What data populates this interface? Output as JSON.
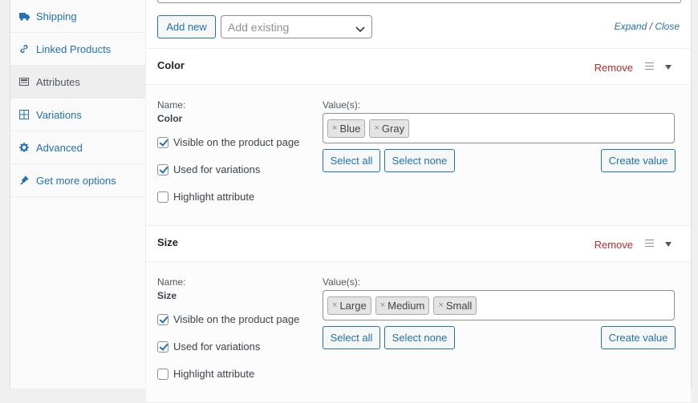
{
  "sidebar": {
    "items": [
      {
        "label": "Shipping",
        "icon": "truck-icon",
        "active": false
      },
      {
        "label": "Linked Products",
        "icon": "link-icon",
        "active": false
      },
      {
        "label": "Attributes",
        "icon": "list-icon",
        "active": true
      },
      {
        "label": "Variations",
        "icon": "grid-icon",
        "active": false
      },
      {
        "label": "Advanced",
        "icon": "gear-icon",
        "active": false
      },
      {
        "label": "Get more options",
        "icon": "plugin-icon",
        "active": false
      }
    ]
  },
  "toolbar": {
    "add_new_label": "Add new",
    "add_existing_placeholder": "Add existing",
    "expand_label": "Expand",
    "separator": "/",
    "close_label": "Close"
  },
  "attributes": [
    {
      "title": "Color",
      "remove_label": "Remove",
      "name_label": "Name:",
      "name_value": "Color",
      "values_label": "Value(s):",
      "values": [
        "Blue",
        "Gray"
      ],
      "visible_label": "Visible on the product page",
      "visible_checked": true,
      "variations_label": "Used for variations",
      "variations_checked": true,
      "highlight_label": "Highlight attribute",
      "highlight_checked": false,
      "select_all_label": "Select all",
      "select_none_label": "Select none",
      "create_value_label": "Create value"
    },
    {
      "title": "Size",
      "remove_label": "Remove",
      "name_label": "Name:",
      "name_value": "Size",
      "values_label": "Value(s):",
      "values": [
        "Large",
        "Medium",
        "Small"
      ],
      "visible_label": "Visible on the product page",
      "visible_checked": true,
      "variations_label": "Used for variations",
      "variations_checked": true,
      "highlight_label": "Highlight attribute",
      "highlight_checked": false,
      "select_all_label": "Select all",
      "select_none_label": "Select none",
      "create_value_label": "Create value"
    }
  ],
  "colors": {
    "link": "#2271b1",
    "remove": "#b32d2e",
    "text": "#3c434a"
  }
}
